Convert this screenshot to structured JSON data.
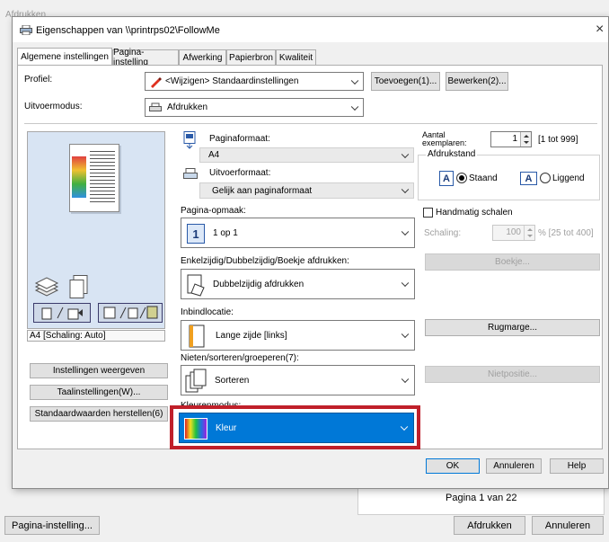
{
  "background_window": {
    "title_partial": "Afdrukken",
    "page_indicator": "Pagina 1 van 22",
    "page_setup_button": "Pagina-instelling...",
    "print_button": "Afdrukken",
    "cancel_button": "Annuleren"
  },
  "dialog": {
    "title": "Eigenschappen van \\\\printrps02\\FollowMe",
    "close": "×"
  },
  "tabs": [
    {
      "label": "Algemene instellingen"
    },
    {
      "label": "Pagina-instelling"
    },
    {
      "label": "Afwerking"
    },
    {
      "label": "Papierbron"
    },
    {
      "label": "Kwaliteit"
    }
  ],
  "profile": {
    "label": "Profiel:",
    "value": "<Wijzigen> Standaardinstellingen",
    "add_button": "Toevoegen(1)...",
    "edit_button": "Bewerken(2)..."
  },
  "output_method": {
    "label": "Uitvoermodus:",
    "value": "Afdrukken"
  },
  "preview": {
    "status": "A4 [Schaling: Auto]"
  },
  "left_buttons": {
    "show_settings": "Instellingen weergeven",
    "language": "Taalinstellingen(W)...",
    "restore_defaults": "Standaardwaarden herstellen(6)"
  },
  "page_size": {
    "label": "Paginaformaat:",
    "value": "A4"
  },
  "output_size": {
    "label": "Uitvoerformaat:",
    "value": "Gelijk aan paginaformaat"
  },
  "page_layout": {
    "label": "Pagina-opmaak:",
    "icon_number": "1",
    "value": "1 op 1"
  },
  "duplex": {
    "label": "Enkelzijdig/Dubbelzijdig/Boekje afdrukken:",
    "value": "Dubbelzijdig afdrukken"
  },
  "binding": {
    "label": "Inbindlocatie:",
    "value": "Lange zijde [links]"
  },
  "collate": {
    "label": "Nieten/sorteren/groeperen(7):",
    "value": "Sorteren"
  },
  "color_mode": {
    "label": "Kleurenmodus:",
    "value": "Kleur",
    "highlight_color": "#c0202a",
    "selected_bg": "#0078d7"
  },
  "copies": {
    "label_line1": "Aantal",
    "label_line2": "exemplaren:",
    "value": "1",
    "range": "[1 tot 999]"
  },
  "orientation": {
    "group_label": "Afdrukstand",
    "portrait": "Staand",
    "landscape": "Liggend",
    "selected": "portrait"
  },
  "manual_scale": {
    "label": "Handmatig schalen",
    "checked": false
  },
  "scaling": {
    "label": "Schaling:",
    "value": "100",
    "range": "% [25 tot 400]"
  },
  "right_buttons": {
    "booklet": "Boekje...",
    "gutter": "Rugmarge...",
    "staple_position": "Nietpositie..."
  },
  "footer": {
    "ok": "OK",
    "cancel": "Annuleren",
    "help": "Help"
  }
}
